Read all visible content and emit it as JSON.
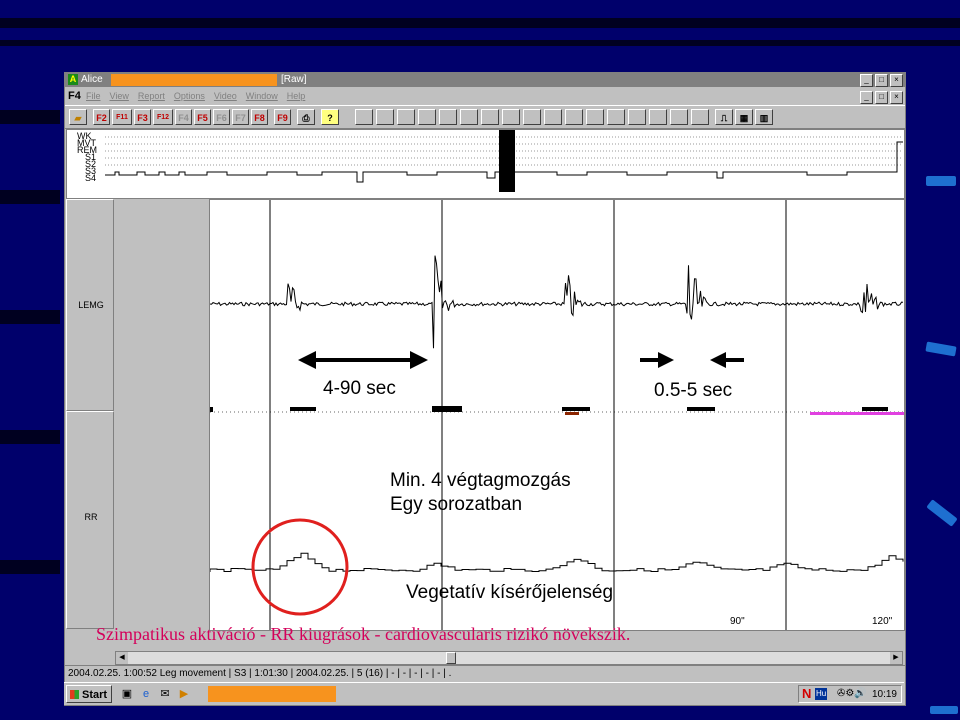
{
  "window": {
    "app_name": "Alice",
    "document": "[Raw]",
    "min": "_",
    "max": "□",
    "close": "×"
  },
  "menubar": {
    "mode": "F4",
    "items": [
      "File",
      "View",
      "Report",
      "Options",
      "Video",
      "Window",
      "Help"
    ]
  },
  "toolbar": {
    "keys": [
      "F2",
      "F11",
      "F3",
      "F12",
      "F4",
      "F5",
      "F6",
      "F7",
      "F8",
      "F9"
    ],
    "help": "?"
  },
  "hypnogram": {
    "labels": [
      "WK",
      "MVT",
      "REM",
      "S1",
      "S2",
      "S3",
      "S4"
    ]
  },
  "channels": {
    "lemg": "LEMG",
    "rr": "RR"
  },
  "annotations": {
    "interval": "4-90 sec",
    "duration": "0.5-5 sec",
    "series_line1": "Min. 4 végtagmozgás",
    "series_line2": "Egy sorozatban",
    "vegetative": "Vegetatív kísérőjelenség",
    "caption": "Szimpatikus aktiváció - RR kiugrások - cardiovascularis rizikó növekszik."
  },
  "time_axis": {
    "mark_90": "90\"",
    "mark_120": "120\""
  },
  "status": {
    "text": "2004.02.25. 1:00:52 Leg movement | S3 | 1:01:30 | 2004.02.25. | 5 (16) | - | - | - | - | - | ."
  },
  "taskbar": {
    "start": "Start",
    "lang": "Hu",
    "clock": "10:19"
  },
  "colors": {
    "slide_bg": "#00006b",
    "accent_orange": "#f7931e",
    "circle_red": "#e0201e",
    "caption_magenta": "#d4005a",
    "marker_magenta": "#e040e0"
  }
}
